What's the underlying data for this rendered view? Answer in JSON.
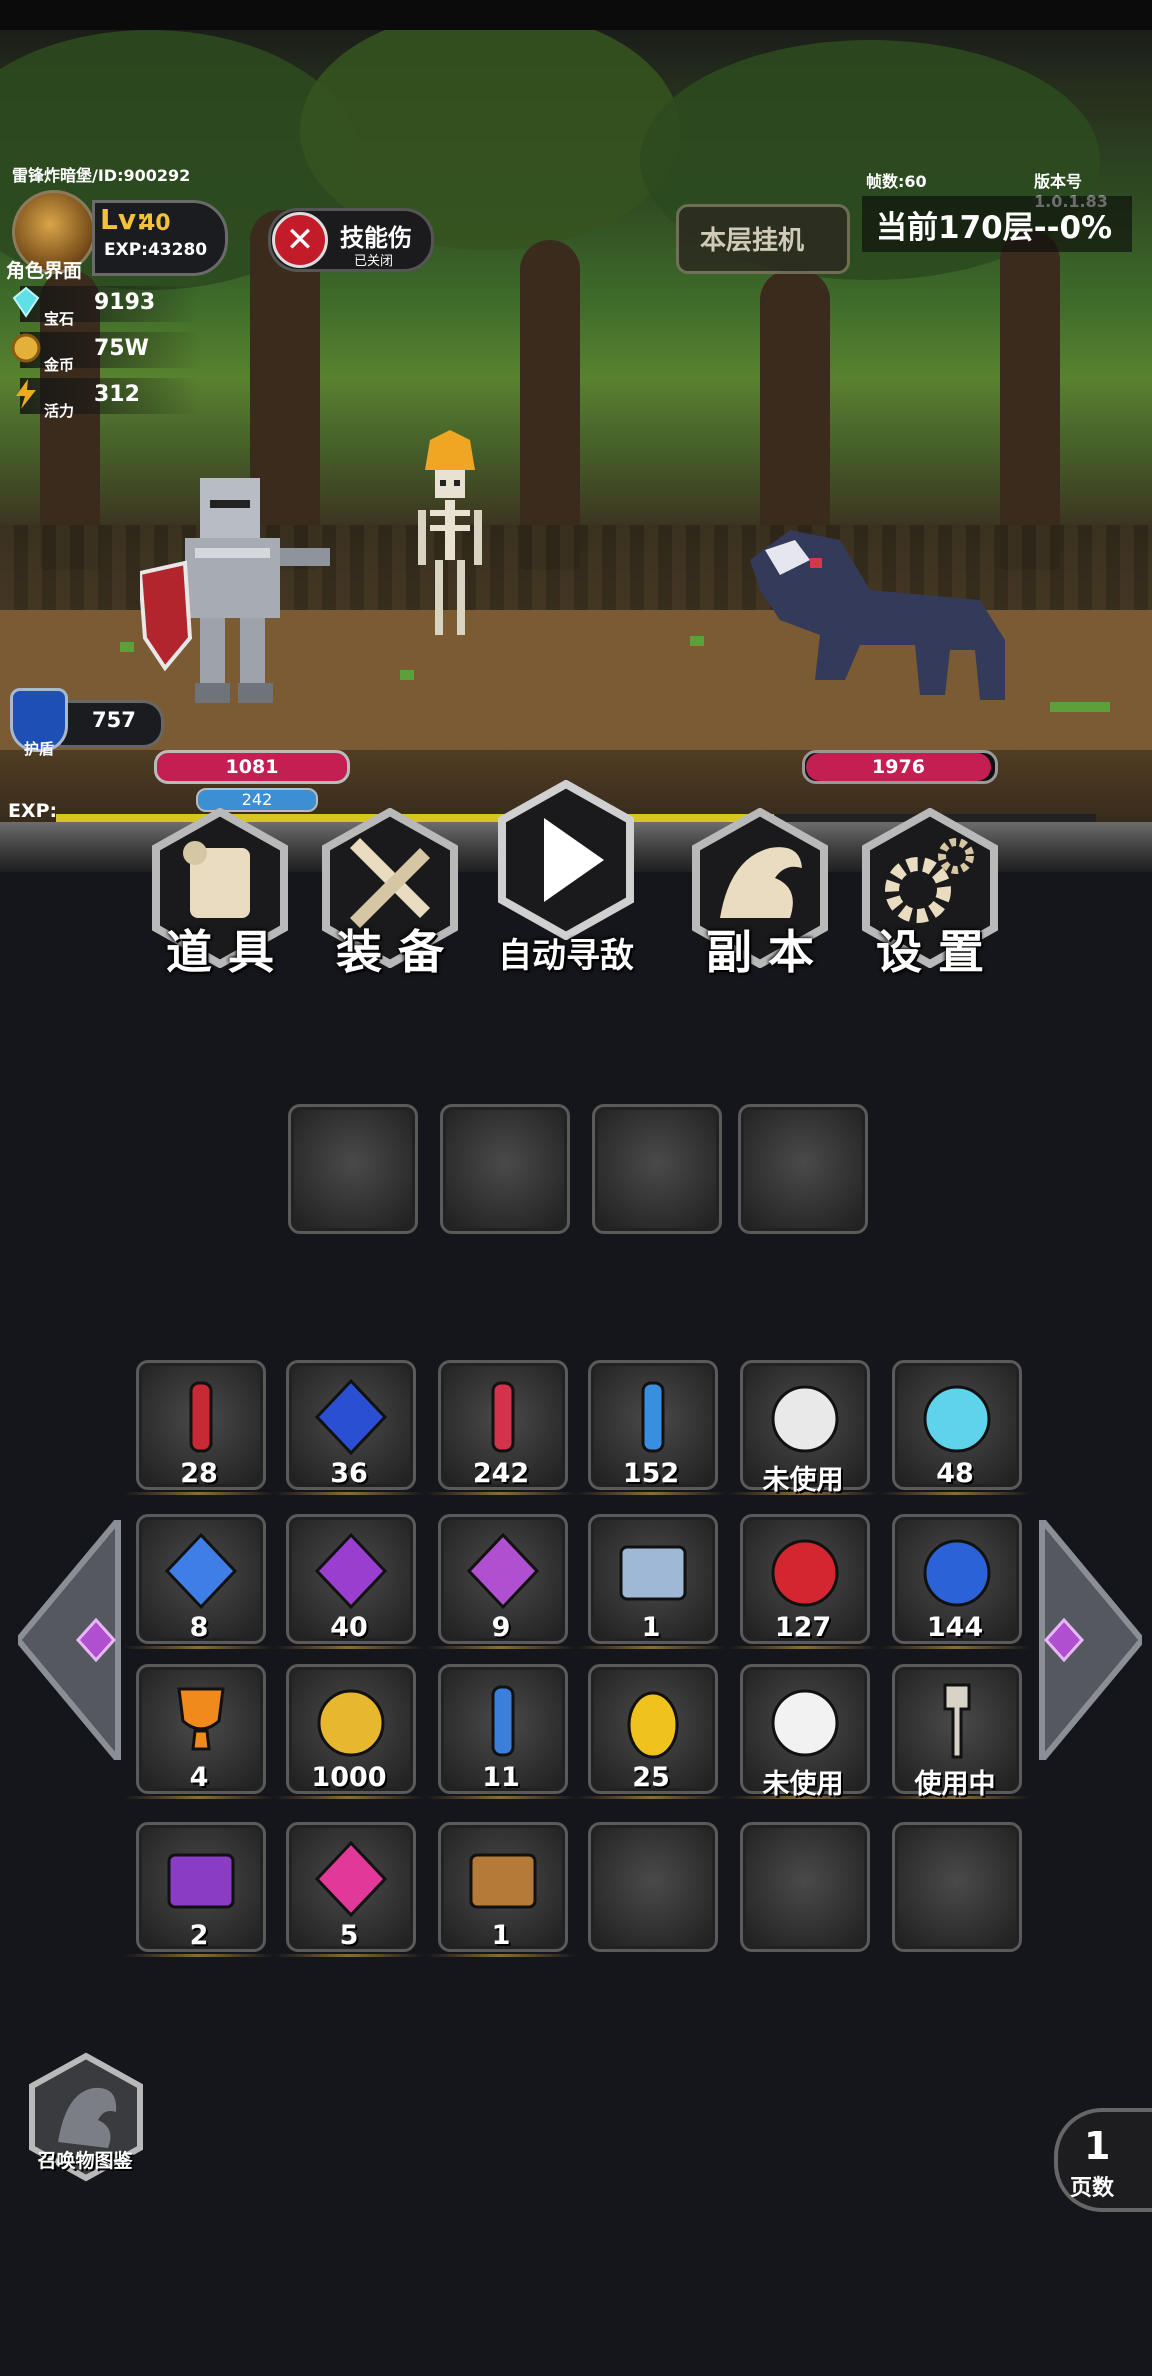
{
  "header": {
    "player_name": "雷锋炸暗堡/ID:900292",
    "lv_label": "Lv:",
    "lv_value": "40",
    "exp_text": "EXP:43280",
    "character_label": "角色界面",
    "fps": "帧数:60",
    "version": "版本号1.0.1.83",
    "idle_button": "本层挂机",
    "floor_progress": "当前170层--0%"
  },
  "resources": [
    {
      "name": "宝石",
      "value": "9193",
      "icon": "gem-icon",
      "color": "#5fe0e6"
    },
    {
      "name": "金币",
      "value": "75W",
      "icon": "coin-icon",
      "color": "#e3b13a"
    },
    {
      "name": "活力",
      "value": "312",
      "icon": "lightning-icon",
      "color": "#f0a81c"
    }
  ],
  "skill": {
    "label": "技能伤",
    "sub": "已关闭",
    "icon": "close-x-icon"
  },
  "battle": {
    "shield_label": "护盾",
    "shield_value": "757",
    "player_hp": "1081",
    "player_mp": "242",
    "enemy_hp": "1976",
    "exp_label": "EXP:",
    "exp_progress": 0.69
  },
  "menu": [
    {
      "label": "道 具",
      "icon": "scroll-icon"
    },
    {
      "label": "装 备",
      "icon": "sword-icon"
    },
    {
      "label": "自动寻敌",
      "icon": "play-icon"
    },
    {
      "label": "副 本",
      "icon": "dragon-icon"
    },
    {
      "label": "设 置",
      "icon": "gear-icon"
    }
  ],
  "equip_slots": 4,
  "inventory": [
    [
      {
        "count": "28",
        "icon": "red-vial-icon"
      },
      {
        "count": "36",
        "icon": "blue-cross-gem-icon"
      },
      {
        "count": "242",
        "icon": "red-tube-icon"
      },
      {
        "count": "152",
        "icon": "blue-tube-icon"
      },
      {
        "count": "未使用",
        "icon": "chicken-icon"
      },
      {
        "count": "48",
        "icon": "cyan-flask-icon"
      }
    ],
    [
      {
        "count": "8",
        "icon": "sapphire-gold-icon"
      },
      {
        "count": "40",
        "icon": "purple-crystal-icon"
      },
      {
        "count": "9",
        "icon": "amethyst-icon"
      },
      {
        "count": "1",
        "icon": "silver-chest-icon"
      },
      {
        "count": "127",
        "icon": "red-potion-icon"
      },
      {
        "count": "144",
        "icon": "blue-potion-icon"
      }
    ],
    [
      {
        "count": "4",
        "icon": "trophy-icon"
      },
      {
        "count": "1000",
        "icon": "gold-coin-icon"
      },
      {
        "count": "11",
        "icon": "blue-vial-icon"
      },
      {
        "count": "25",
        "icon": "golden-egg-icon"
      },
      {
        "count": "未使用",
        "icon": "white-chicken-icon"
      },
      {
        "count": "使用中",
        "icon": "skeleton-icon"
      }
    ],
    [
      {
        "count": "2",
        "icon": "purple-chest-icon"
      },
      {
        "count": "5",
        "icon": "pink-cross-gem-icon"
      },
      {
        "count": "1",
        "icon": "wooden-chest-icon"
      },
      {
        "count": "",
        "icon": ""
      },
      {
        "count": "",
        "icon": ""
      },
      {
        "count": "",
        "icon": ""
      }
    ]
  ],
  "footer": {
    "summon_label": "召唤物图鉴",
    "page_number": "1",
    "page_label": "页数"
  }
}
